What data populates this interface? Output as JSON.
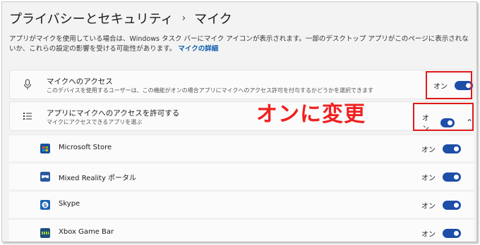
{
  "breadcrumb": {
    "parent": "プライバシーとセキュリティ",
    "separator": "›",
    "current": "マイク"
  },
  "description": {
    "text": "アプリがマイクを使用している場合は、Windows タスク バーにマイク アイコンが表示されます。一部のデスクトップ アプリがこのページに表示されないか、これらの設定の影響を受ける可能性があります。",
    "link": "マイクの詳細"
  },
  "mic_access": {
    "icon": "microphone-icon",
    "title": "マイクへのアクセス",
    "subtitle": "このデバイスを使用するユーザーは、この機能がオンの場合アプリにマイクへのアクセス許可を付与するかどうかを選択できます",
    "state_label": "オン",
    "enabled": true
  },
  "app_access": {
    "icon": "list-icon",
    "title": "アプリにマイクへのアクセスを許可する",
    "subtitle": "マイクにアクセスできるアプリを選ぶ",
    "state_label": "オン",
    "enabled": true,
    "expanded": true
  },
  "annotation": {
    "text": "オンに変更",
    "color": "#f02020"
  },
  "apps": [
    {
      "name": "Microsoft Store",
      "icon": "microsoft-store-icon",
      "state_label": "オン",
      "enabled": true
    },
    {
      "name": "Mixed Reality ポータル",
      "icon": "mixed-reality-portal-icon",
      "state_label": "オン",
      "enabled": true
    },
    {
      "name": "Skype",
      "icon": "skype-icon",
      "state_label": "オン",
      "enabled": true
    },
    {
      "name": "Xbox Game Bar",
      "icon": "xbox-game-bar-icon",
      "state_label": "オン",
      "enabled": true
    }
  ],
  "colors": {
    "toggle_on": "#1d4ea8",
    "link": "#0b5cad",
    "highlight": "#e01a1a"
  }
}
